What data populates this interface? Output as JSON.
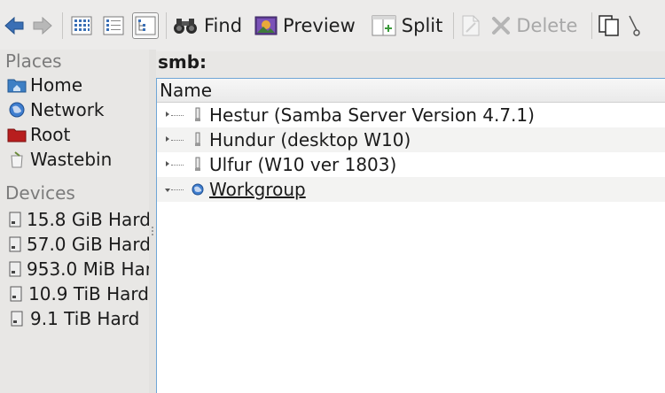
{
  "toolbar": {
    "find_label": "Find",
    "preview_label": "Preview",
    "split_label": "Split",
    "delete_label": "Delete"
  },
  "sidebar": {
    "places_title": "Places",
    "places": [
      {
        "label": "Home",
        "icon": "home-folder-icon"
      },
      {
        "label": "Network",
        "icon": "network-globe-icon"
      },
      {
        "label": "Root",
        "icon": "root-folder-icon"
      },
      {
        "label": "Wastebin",
        "icon": "wastebin-icon"
      }
    ],
    "devices_title": "Devices",
    "devices": [
      {
        "label": "15.8 GiB Hard",
        "icon": "hard-drive-icon"
      },
      {
        "label": "57.0 GiB Hard",
        "icon": "hard-drive-icon"
      },
      {
        "label": "953.0 MiB Hard",
        "icon": "hard-drive-icon"
      },
      {
        "label": "10.9 TiB Hard",
        "icon": "hard-drive-icon"
      },
      {
        "label": "9.1 TiB Hard",
        "icon": "hard-drive-icon"
      }
    ]
  },
  "main": {
    "path": "smb:",
    "column_name": "Name",
    "rows": [
      {
        "label": "Hestur (Samba Server Version 4.7.1)",
        "icon": "server-icon",
        "expanded": false
      },
      {
        "label": "Hundur (desktop W10)",
        "icon": "server-icon",
        "expanded": false
      },
      {
        "label": "Ulfur (W10 ver 1803)",
        "icon": "server-icon",
        "expanded": false
      },
      {
        "label": "Workgroup",
        "icon": "network-globe-icon",
        "expanded": true
      }
    ]
  },
  "colors": {
    "accent_border": "#6fa6d6",
    "background": "#e8e7e5"
  }
}
